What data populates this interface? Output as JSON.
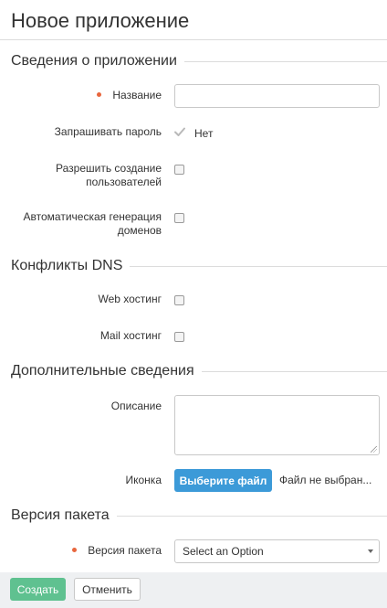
{
  "page": {
    "title": "Новое приложение"
  },
  "sections": {
    "app_info": "Сведения о приложении",
    "dns": "Конфликты DNS",
    "extra": "Дополнительные сведения",
    "package": "Версия пакета"
  },
  "fields": {
    "name_label": "Название",
    "name_value": "",
    "ask_password_label": "Запрашивать пароль",
    "ask_password_value": "Нет",
    "allow_users_label": "Разрешить создание пользователей",
    "auto_domains_label": "Автоматическая генерация доменов",
    "web_hosting_label": "Web хостинг",
    "mail_hosting_label": "Mail хостинг",
    "description_label": "Описание",
    "icon_label": "Иконка",
    "choose_file_button": "Выберите файл",
    "file_status": "Файл не выбран...",
    "package_version_label": "Версия пакета",
    "package_version_value": "Select an Option"
  },
  "checkboxes": {
    "allow_users": false,
    "auto_domains": false,
    "web_hosting": false,
    "mail_hosting": false
  },
  "footer": {
    "create_button": "Создать",
    "cancel_button": "Отменить"
  },
  "colors": {
    "required_dot": "#e8663d",
    "primary_blue": "#3c9ad8",
    "create_green": "#5fc190"
  },
  "icons": {
    "required": "required-dot-icon",
    "check": "checkmark-icon",
    "select_caret": "chevron-down-icon",
    "resize": "resize-grip-icon"
  }
}
